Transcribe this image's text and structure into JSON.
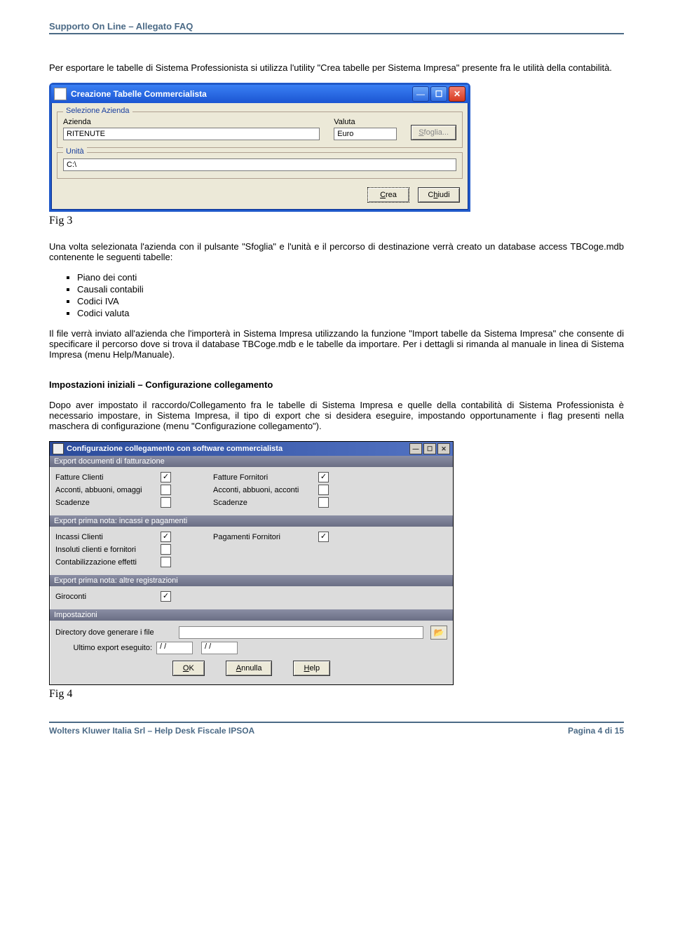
{
  "header": {
    "title": "Supporto On Line – Allegato FAQ"
  },
  "intro": "Per esportare le tabelle di Sistema Professionista si utilizza l'utility \"Crea tabelle per Sistema Impresa\" presente fra le utilità della contabilità.",
  "win1": {
    "title": "Creazione Tabelle Commercialista",
    "group1": "Selezione Azienda",
    "azienda_label": "Azienda",
    "azienda_value": "RITENUTE",
    "valuta_label": "Valuta",
    "valuta_value": "Euro",
    "sfoglia": "Sfoglia...",
    "group2": "Unità",
    "unita_value": "C:\\",
    "crea": "Crea",
    "chiudi": "Chiudi"
  },
  "fig3": "Fig 3",
  "para2": "Una volta selezionata l'azienda con il pulsante \"Sfoglia\" e l'unità e il percorso di destinazione verrà creato un database access TBCoge.mdb contenente le seguenti tabelle:",
  "bullets": {
    "a": "Piano dei conti",
    "b": "Causali contabili",
    "c": "Codici IVA",
    "d": "Codici valuta"
  },
  "para3": "Il file verrà inviato all'azienda che l'importerà in Sistema Impresa utilizzando la funzione \"Import tabelle da Sistema Impresa\" che consente di specificare il percorso dove si trova il database TBCoge.mdb e le tabelle da importare. Per i dettagli si rimanda al manuale in linea di Sistema Impresa (menu Help/Manuale).",
  "h2": "Impostazioni iniziali – Configurazione collegamento",
  "para4": "Dopo aver impostato il raccordo/Collegamento fra le tabelle di Sistema Impresa e quelle della contabilità di Sistema Professionista è necessario impostare, in Sistema Impresa, il tipo di export che si desidera eseguire, impostando opportunamente i flag presenti nella maschera di configurazione (menu \"Configurazione collegamento\").",
  "win2": {
    "title": "Configurazione collegamento con software commercialista",
    "sec1": "Export documenti di fatturazione",
    "r1a": "Fatture Clienti",
    "r1b": "Fatture Fornitori",
    "r2a": "Acconti, abbuoni, omaggi",
    "r2b": "Acconti, abbuoni, acconti",
    "r3a": "Scadenze",
    "r3b": "Scadenze",
    "sec2": "Export prima nota: incassi e pagamenti",
    "r4a": "Incassi Clienti",
    "r4b": "Pagamenti Fornitori",
    "r5a": "Insoluti clienti e fornitori",
    "r6a": "Contabilizzazione effetti",
    "sec3": "Export prima nota: altre registrazioni",
    "r7a": "Giroconti",
    "sec4": "Impostazioni",
    "dir_label": "Directory dove generare i file",
    "last_label": "Ultimo export eseguito:",
    "date1": "/ /",
    "date2": "/ /",
    "ok": "OK",
    "annulla": "Annulla",
    "help": "Help"
  },
  "fig4": "Fig 4",
  "footer": {
    "left": "Wolters Kluwer Italia Srl – Help Desk Fiscale IPSOA",
    "right": "Pagina 4 di 15"
  }
}
